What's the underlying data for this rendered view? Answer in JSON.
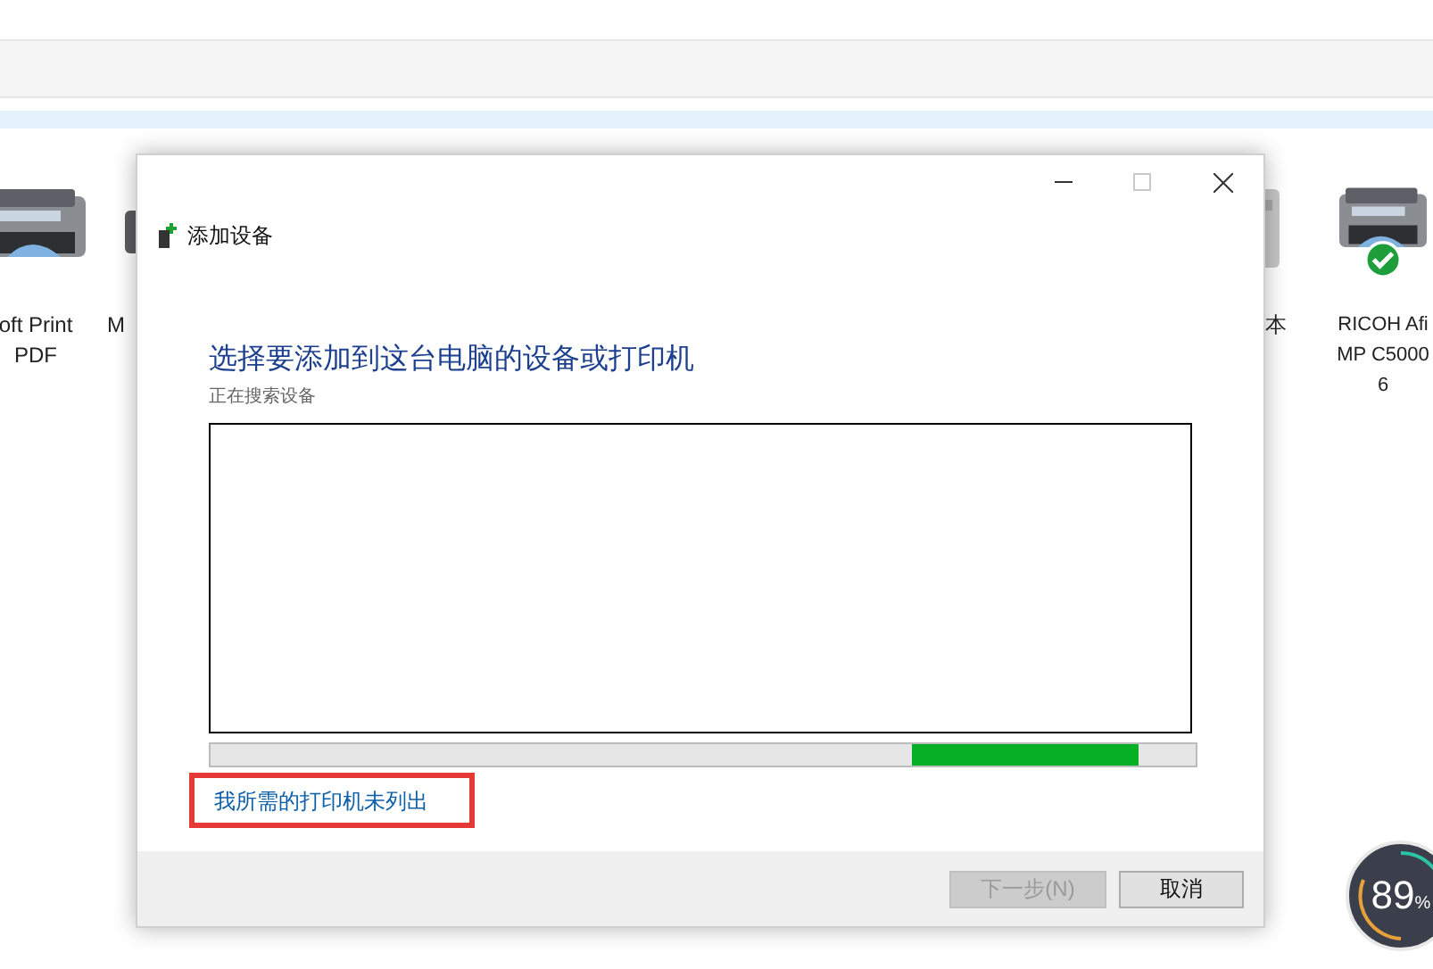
{
  "background": {
    "devices": [
      {
        "kind": "printer",
        "lines": [
          "oft Print",
          "PDF"
        ],
        "default": false
      },
      {
        "kind": "fax",
        "lines": [
          "M"
        ],
        "default": false
      },
      {
        "kind": "device",
        "lines": [
          "本"
        ],
        "default": false
      },
      {
        "kind": "printer",
        "lines": [
          "RICOH Afi",
          "MP C5000",
          "6"
        ],
        "default": true
      }
    ]
  },
  "dialog": {
    "title": "添加设备",
    "heading": "选择要添加到这台电脑的设备或打印机",
    "status": "正在搜索设备",
    "link": {
      "label": "我所需的打印机未列出",
      "highlighted": true
    },
    "buttons": [
      {
        "label": "下一步(N)",
        "disabled": true
      },
      {
        "label": "取消",
        "disabled": false
      }
    ]
  },
  "gauge": {
    "reading": "89",
    "unit": "%"
  }
}
